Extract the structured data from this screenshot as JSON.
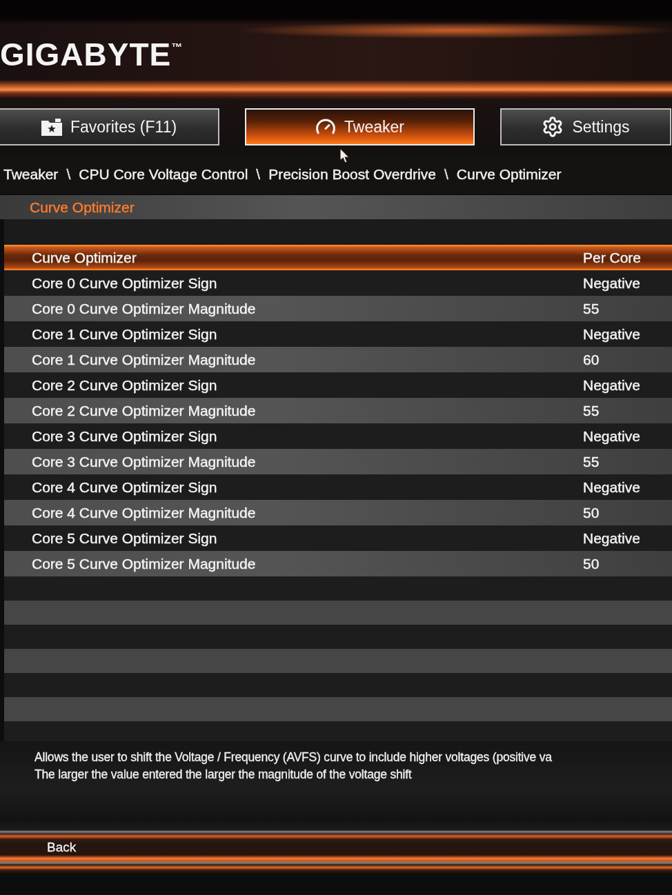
{
  "header": {
    "logo": "GIGABYTE$^{™}$"
  },
  "tabs": [
    {
      "kind": "favorites",
      "label": "Favorites (F11)",
      "selected": false
    },
    {
      "kind": "tweaker",
      "label": "Tweaker",
      "selected": true
    },
    {
      "kind": "settings",
      "label": "Settings",
      "selected": false
    }
  ],
  "breadcrumb": {
    "separator": "\\",
    "items": [
      "Tweaker",
      "CPU Core Voltage Control",
      "Precision Boost Overdrive",
      "Curve Optimizer"
    ]
  },
  "section": {
    "title": "Curve Optimizer"
  },
  "settings": [
    {
      "label": "Curve Optimizer",
      "value": "Per Core",
      "selected": true
    },
    {
      "label": "Core 0 Curve Optimizer Sign",
      "value": "Negative",
      "selected": false
    },
    {
      "label": "Core 0 Curve Optimizer Magnitude",
      "value": "55",
      "selected": false
    },
    {
      "label": "Core 1 Curve Optimizer Sign",
      "value": "Negative",
      "selected": false
    },
    {
      "label": "Core 1 Curve Optimizer Magnitude",
      "value": "60",
      "selected": false
    },
    {
      "label": "Core 2 Curve Optimizer Sign",
      "value": "Negative",
      "selected": false
    },
    {
      "label": "Core 2 Curve Optimizer Magnitude",
      "value": "55",
      "selected": false
    },
    {
      "label": "Core 3 Curve Optimizer Sign",
      "value": "Negative",
      "selected": false
    },
    {
      "label": "Core 3 Curve Optimizer Magnitude",
      "value": "55",
      "selected": false
    },
    {
      "label": "Core 4 Curve Optimizer Sign",
      "value": "Negative",
      "selected": false
    },
    {
      "label": "Core 4 Curve Optimizer Magnitude",
      "value": "50",
      "selected": false
    },
    {
      "label": "Core 5 Curve Optimizer Sign",
      "value": "Negative",
      "selected": false
    },
    {
      "label": "Core 5 Curve Optimizer Magnitude",
      "value": "50",
      "selected": false
    }
  ],
  "help_text": [
    "Allows the user to shift the Voltage / Frequency (AVFS) curve to include higher voltages (positive va",
    "The larger the value entered the larger the magnitude of the voltage shift"
  ],
  "footer": {
    "back": "Back"
  }
}
